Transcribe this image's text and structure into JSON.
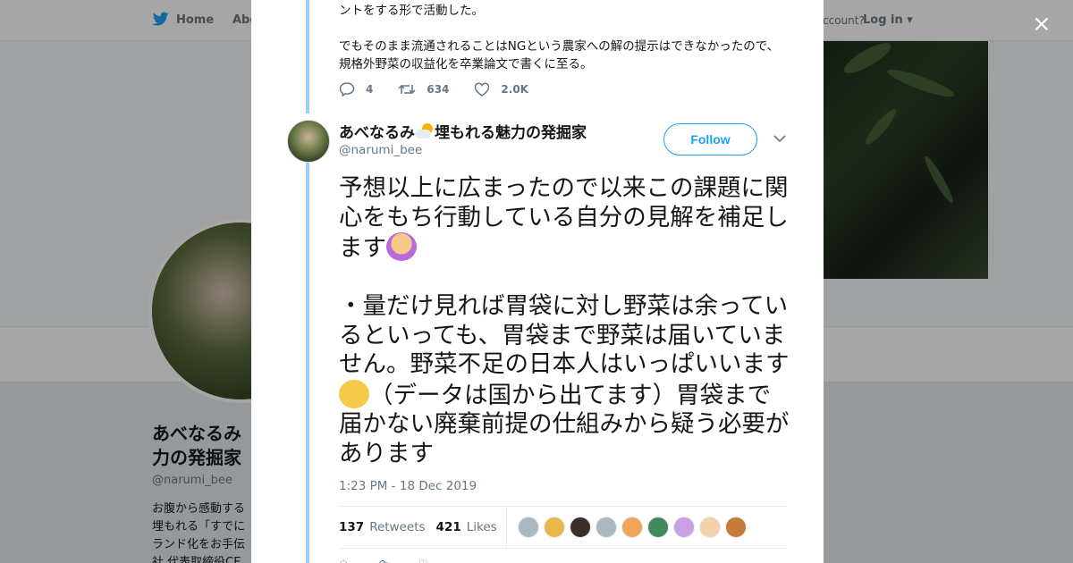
{
  "background": {
    "nav": {
      "home_label": "Home",
      "about_label": "Abo",
      "have_account": "ccount?",
      "login_label": "Log in"
    },
    "profile": {
      "name": "あべなるみ\n力の発掘家",
      "handle": "@narumi_bee",
      "bio": "お腹から感動する\n埋もれる「すでに\nランド化をお手伝\n社 代表取締役CE"
    }
  },
  "modal": {
    "close_label": "×",
    "previous_tweet": {
      "line1": "ントをする形で活動した。",
      "line2": "でもそのまま流通されることはNGという農家への解の提示はできなかったので、規格外野菜の収益化を卒業論文で書くに至る。",
      "replies": "4",
      "retweets": "634",
      "likes": "2.0K"
    },
    "tweet": {
      "display_name_a": "あべなるみ",
      "display_name_b": "埋もれる魅力の発掘家",
      "handle": "@narumi_bee",
      "follow_label": "Follow",
      "text_part1": "予想以上に広まったので以来この課題に関心をもち行動している自分の見解を補足します",
      "text_part2": "・量だけ見れば胃袋に対し野菜は余っているといっても、胃袋まで野菜は届いていません。野菜不足の日本人はいっぱいいます",
      "text_part3": "（データは国から出てます）胃袋まで届かない廃棄前提の仕組みから疑う必要があります",
      "timestamp": "1:23 PM - 18 Dec 2019",
      "retweets_count": "137",
      "retweets_label": "Retweets",
      "likes_count": "421",
      "likes_label": "Likes"
    },
    "liker_colors": [
      "#aab8c2",
      "#e8b84a",
      "#3a2f2a",
      "#aab8c2",
      "#f1a45b",
      "#3f8a5a",
      "#c9a0e6",
      "#f4d2a8",
      "#c87a3a"
    ]
  },
  "colors": {
    "accent": "#1da1f2",
    "thread_line": "#9ecff3"
  }
}
